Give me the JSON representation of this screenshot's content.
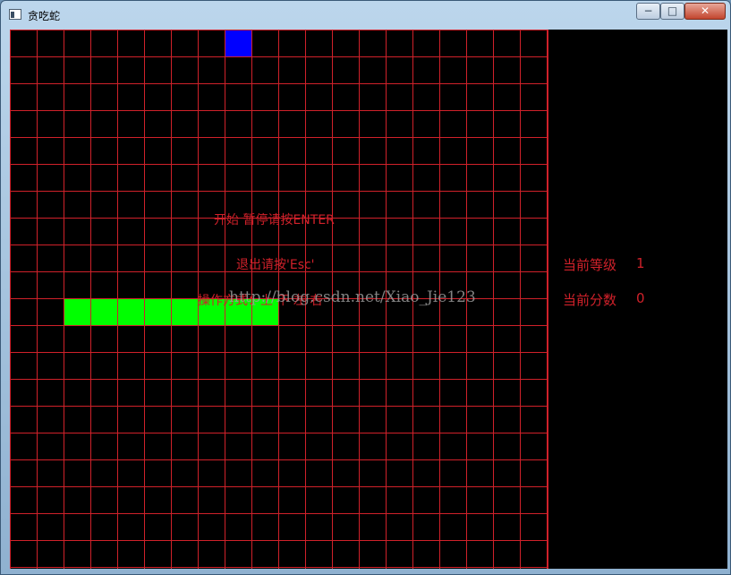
{
  "window": {
    "title": "贪吃蛇",
    "minimize": "−",
    "maximize": "□",
    "close": "✕"
  },
  "board": {
    "columns": 20,
    "rows": 20,
    "grid_color": "#d0212a",
    "background": "#000000",
    "food_color": "#0000ff",
    "snake_color": "#00ff00"
  },
  "food": {
    "col": 8,
    "row": 0
  },
  "snake": [
    {
      "col": 2,
      "row": 10
    },
    {
      "col": 3,
      "row": 10
    },
    {
      "col": 4,
      "row": 10
    },
    {
      "col": 5,
      "row": 10
    },
    {
      "col": 6,
      "row": 10
    },
    {
      "col": 7,
      "row": 10
    },
    {
      "col": 8,
      "row": 10
    },
    {
      "col": 9,
      "row": 10
    }
  ],
  "messages": {
    "start_pause": "开始 暂停请按ENTER",
    "quit": "退出请按'Esc'",
    "controls": "操作方式：上 下 左 右"
  },
  "stats": {
    "level_label": "当前等级",
    "level_value": "1",
    "score_label": "当前分数",
    "score_value": "0"
  },
  "watermark": "http://blog.csdn.net/Xiao_Jie123"
}
